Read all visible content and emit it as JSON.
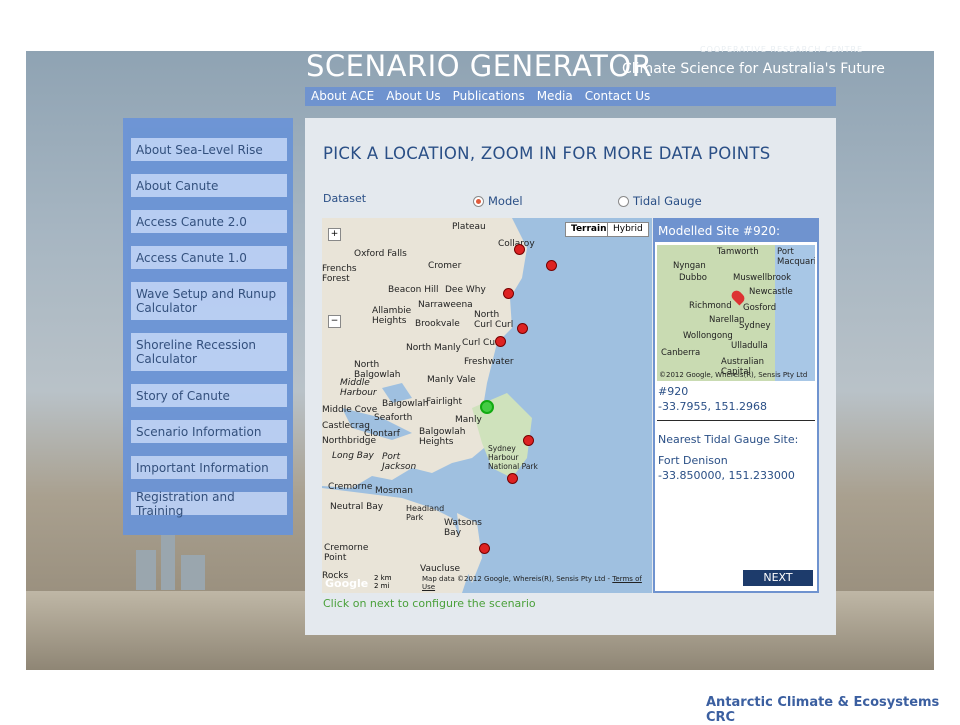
{
  "header": {
    "top_text": "COOPERATIVE RESEARCH CENTRE",
    "title": "SCENARIO GENERATOR",
    "subtitle": "Climate Science for Australia's Future"
  },
  "topnav": [
    "About ACE",
    "About Us",
    "Publications",
    "Media",
    "Contact Us"
  ],
  "sidebar": [
    "About Sea-Level Rise",
    "About Canute",
    "Access Canute 2.0",
    "Access Canute 1.0",
    "Wave Setup and Runup Calculator",
    "Shoreline Recession Calculator",
    "Story of Canute",
    "Scenario Information",
    "Important Information",
    "Registration and Training"
  ],
  "panel": {
    "title": "PICK A LOCATION, ZOOM IN FOR MORE DATA POINTS",
    "dataset_label": "Dataset",
    "options": [
      {
        "label": "Model",
        "selected": true
      },
      {
        "label": "Tidal Gauge",
        "selected": false
      }
    ],
    "hint": "Click on next to configure the scenario"
  },
  "map": {
    "type_buttons": [
      "Terrain",
      "Hybrid"
    ],
    "active_type": "Terrain",
    "places": [
      "Plateau",
      "Collaroy",
      "Oxford Falls",
      "Frenchs Forest",
      "Cromer",
      "Beacon Hill",
      "Dee Why",
      "Allambie Heights",
      "Narraweena",
      "Brookvale",
      "North Curl Curl",
      "Curl Curl",
      "North Manly",
      "Freshwater",
      "North Balgowlah",
      "Manly Vale",
      "Middle Harbour",
      "Balgowlah",
      "Fairlight",
      "Middle Cove",
      "Seaforth",
      "Manly",
      "Castlecrag",
      "Clontarf",
      "Balgowlah Heights",
      "Northbridge",
      "Long Bay",
      "Port Jackson",
      "Sydney Harbour National Park",
      "Cremorne",
      "Mosman",
      "Neutral Bay",
      "Headland Park",
      "Watsons Bay",
      "Cremorne Point",
      "Vaucluse",
      "Rocks"
    ],
    "scale": [
      "2 km",
      "2 mi"
    ],
    "copyright": "Map data ©2012 Google, Whereis(R), Sensis Pty Ltd -",
    "terms": "Terms of Use",
    "logo": "Google"
  },
  "info": {
    "header": "Modelled Site #920:",
    "thumb_places": [
      "Tamworth",
      "Port Macquarie",
      "Nyngan",
      "Dubbo",
      "Muswellbrook",
      "Newcastle",
      "Richmond",
      "Gosford",
      "Narellan",
      "Sydney",
      "Wollongong",
      "Canberra",
      "Ulladulla",
      "Australian Capital"
    ],
    "thumb_copy": "©2012 Google, Whereis(R), Sensis Pty Ltd",
    "site_id": "#920",
    "site_coords": "-33.7955, 151.2968",
    "nearest_label": "Nearest Tidal Gauge Site:",
    "nearest_name": "Fort Denison",
    "nearest_coords": "-33.850000, 151.233000",
    "next_button": "NEXT"
  },
  "footer": "Antarctic Climate & Ecosystems CRC",
  "colors": {
    "nav": "#6f93cf",
    "sidebar": "#6b94d6",
    "button": "#b9cff5",
    "next": "#1d3b6b",
    "marker": "#dd2222",
    "selected_marker": "#44cc44"
  }
}
